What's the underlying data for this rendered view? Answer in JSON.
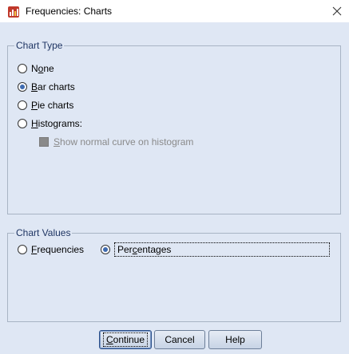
{
  "window": {
    "title": "Frequencies: Charts",
    "background": "#dfe7f4"
  },
  "chart_type": {
    "legend": "Chart Type",
    "options": [
      {
        "pre": "N",
        "key": "o",
        "post": "ne",
        "selected": false
      },
      {
        "pre": "",
        "key": "B",
        "post": "ar charts",
        "selected": true
      },
      {
        "pre": "",
        "key": "P",
        "post": "ie charts",
        "selected": false
      },
      {
        "pre": "",
        "key": "H",
        "post": "istograms:",
        "selected": false
      }
    ],
    "normal_curve": {
      "pre": "",
      "key": "S",
      "post": "how normal curve on histogram",
      "enabled": false
    }
  },
  "chart_values": {
    "legend": "Chart Values",
    "options": [
      {
        "pre": "",
        "key": "F",
        "post": "requencies",
        "selected": false
      },
      {
        "pre": "Per",
        "key": "c",
        "post": "entages",
        "selected": true
      }
    ]
  },
  "buttons": {
    "continue": {
      "pre": "",
      "key": "C",
      "post": "ontinue"
    },
    "cancel": "Cancel",
    "help": "Help"
  }
}
